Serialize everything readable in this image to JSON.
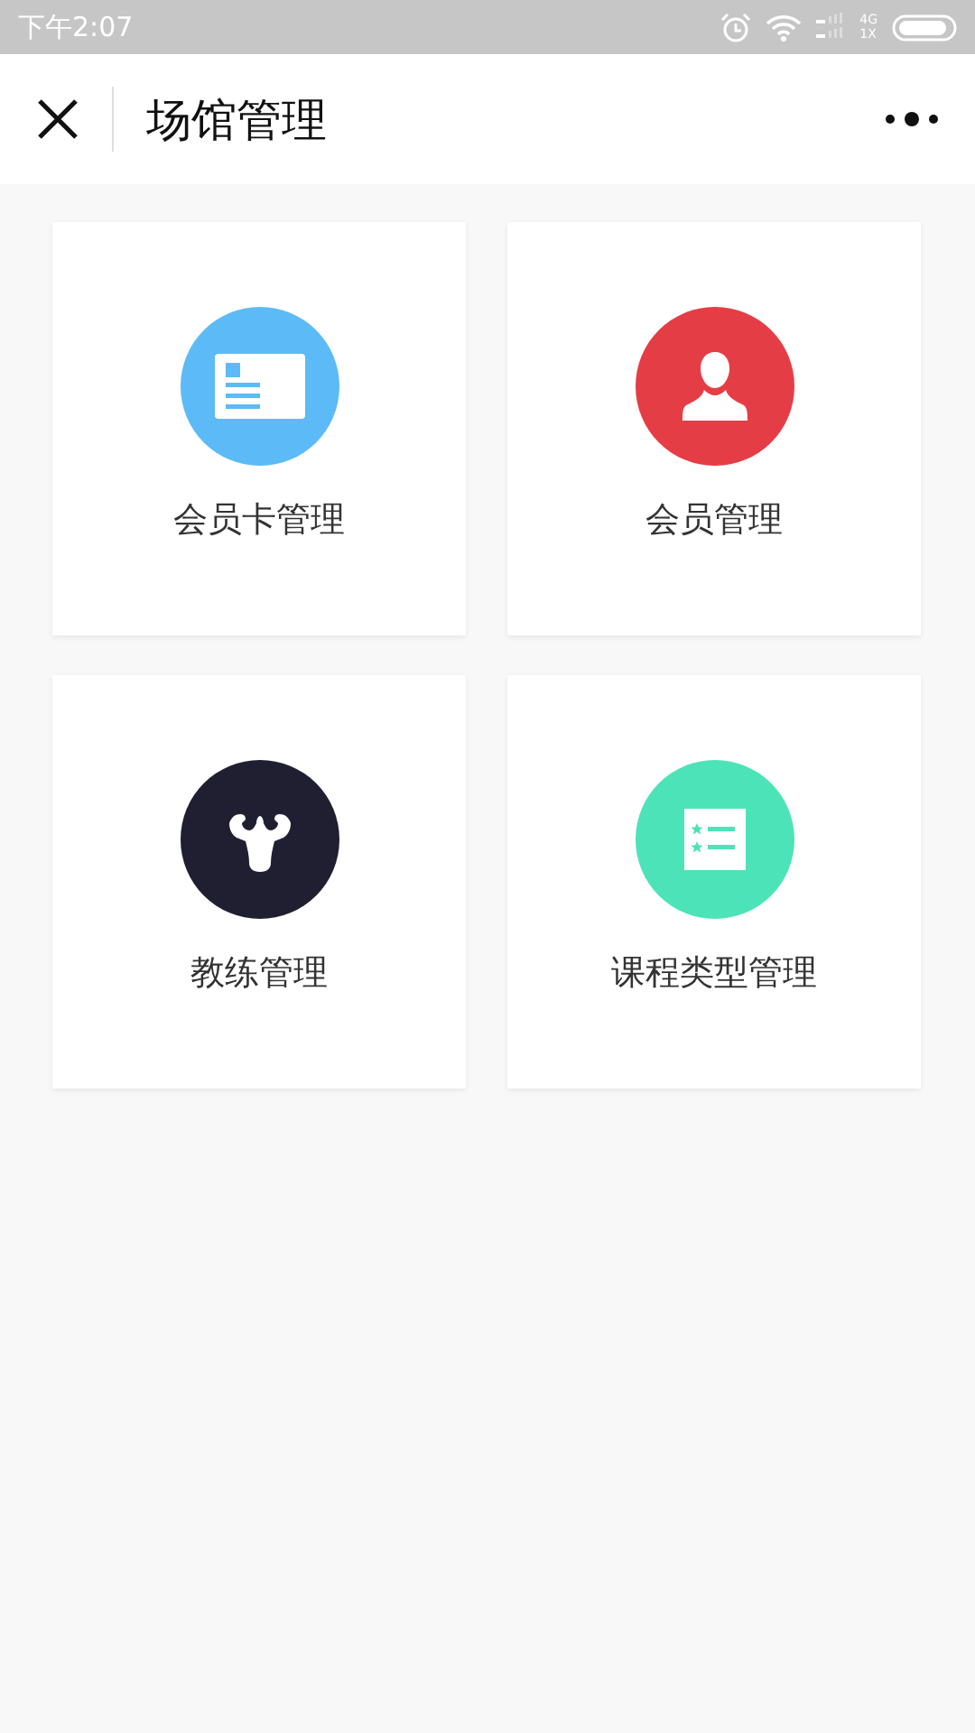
{
  "status_bar": {
    "time": "下午2:07",
    "network_top": "4G",
    "network_bottom": "1X"
  },
  "nav": {
    "title": "场馆管理"
  },
  "tiles": [
    {
      "label": "会员卡管理",
      "kind": "card",
      "color": "#5cbbf6"
    },
    {
      "label": "会员管理",
      "kind": "person",
      "color": "#e53d45"
    },
    {
      "label": "教练管理",
      "kind": "muscle",
      "color": "#201e31"
    },
    {
      "label": "课程类型管理",
      "kind": "list",
      "color": "#4de3b8"
    }
  ]
}
